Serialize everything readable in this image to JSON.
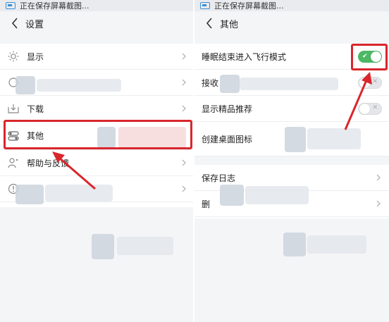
{
  "left": {
    "status_text": "正在保存屏幕截图...",
    "title": "设置",
    "items": [
      {
        "label": "显示",
        "icon": "sun-icon"
      },
      {
        "label": "",
        "icon": "sound-icon"
      },
      {
        "label": "下载",
        "icon": "download-icon"
      },
      {
        "label": "其他",
        "icon": "toggle-settings-icon"
      },
      {
        "label": "帮助与反馈",
        "icon": "feedback-person-icon"
      },
      {
        "label": "",
        "icon": "info-icon"
      }
    ]
  },
  "right": {
    "status_text": "正在保存屏幕截图...",
    "title": "其他",
    "items": [
      {
        "label": "睡眠结束进入飞行模式",
        "control": "toggle-on"
      },
      {
        "label": "接收",
        "control": "toggle-off"
      },
      {
        "label": "显示精品推荐",
        "control": "toggle-off"
      },
      {
        "label": "创建桌面图标",
        "control": "none"
      },
      {
        "label": "保存日志",
        "control": "chevron"
      },
      {
        "label": "删",
        "control": "chevron"
      }
    ]
  },
  "colors": {
    "highlight": "#d9262c",
    "toggle_on": "#4cb864",
    "background": "#f4f5f7"
  }
}
